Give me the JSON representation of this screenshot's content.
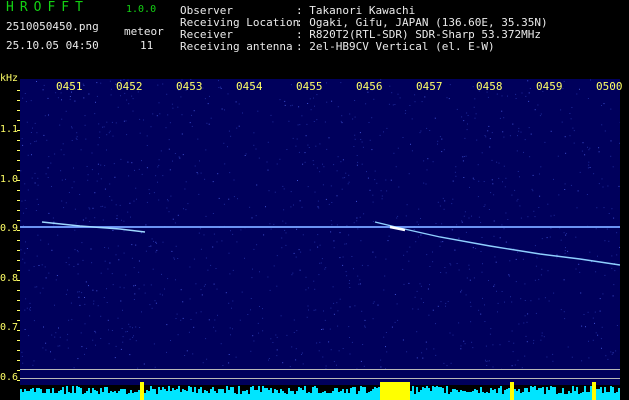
{
  "app": {
    "name": "HROFFT",
    "version": "1.0.0"
  },
  "file": {
    "name": "2510050450.png",
    "datetime": "25.10.05 04:50"
  },
  "meteor": {
    "label": "meteor",
    "count": "11"
  },
  "info": [
    {
      "key": "Observer",
      "value": ": Takanori Kawachi"
    },
    {
      "key": "Receiving Location",
      "value": ": Ogaki, Gifu, JAPAN (136.60E, 35.35N)"
    },
    {
      "key": "Receiver",
      "value": ": R820T2(RTL-SDR) SDR-Sharp 53.372MHz"
    },
    {
      "key": "Receiving antenna",
      "value": ": 2el-HB9CV Vertical (el. E-W)"
    }
  ],
  "axis": {
    "unit": "kHz",
    "x_ticks": [
      "0451",
      "0452",
      "0453",
      "0454",
      "0455",
      "0456",
      "0457",
      "0458",
      "0459",
      "0500"
    ],
    "y_ticks": [
      "1.1",
      "1.0",
      "0.9",
      "0.8",
      "0.7",
      "0.6"
    ]
  },
  "colors": {
    "title": "#13d113",
    "axis": "#ffff66",
    "background": "#00005c",
    "signal": "#9fd8ff",
    "power": "#00e5ff",
    "peak": "#ffff00"
  }
}
